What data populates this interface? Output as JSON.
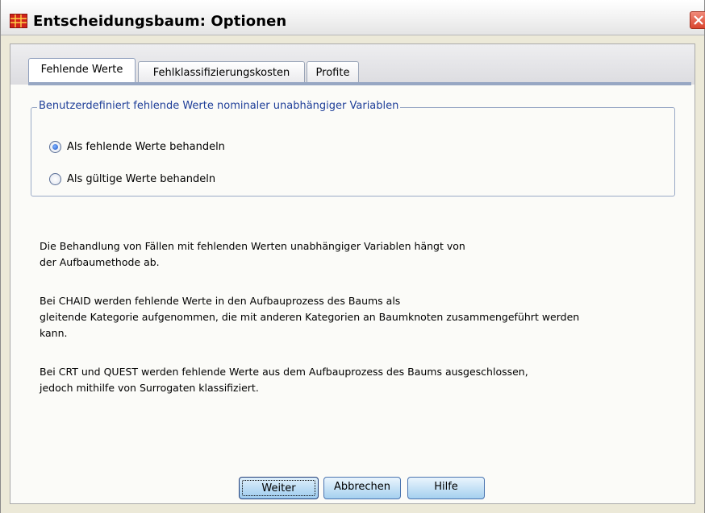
{
  "window": {
    "title": "Entscheidungsbaum: Optionen",
    "icon": "spreadsheet-icon",
    "close_icon": "close-icon"
  },
  "tabs": [
    {
      "label": "Fehlende Werte",
      "active": true
    },
    {
      "label": "Fehlklassifizierungskosten",
      "active": false
    },
    {
      "label": "Profite",
      "active": false
    }
  ],
  "group": {
    "legend": "Benutzerdefiniert fehlende Werte nominaler unabhängiger Variablen",
    "options": [
      {
        "label": "Als fehlende Werte behandeln",
        "checked": true
      },
      {
        "label": "Als gültige Werte behandeln",
        "checked": false
      }
    ]
  },
  "info": {
    "p1_line1": "Die Behandlung von Fällen mit fehlenden Werten unabhängiger Variablen hängt von",
    "p1_line2": "der Aufbaumethode ab.",
    "p2_line1": "Bei CHAID werden fehlende Werte in den Aufbauprozess des Baums als",
    "p2_line2": "gleitende Kategorie aufgenommen, die mit anderen Kategorien an Baumknoten zusammengeführt werden",
    "p2_line3": "kann.",
    "p3_line1": "Bei CRT und QUEST werden fehlende Werte aus dem Aufbauprozess des Baums ausgeschlossen,",
    "p3_line2": "jedoch mithilfe von Surrogaten klassifiziert."
  },
  "buttons": {
    "continue": "Weiter",
    "cancel": "Abbrechen",
    "help": "Hilfe"
  },
  "colors": {
    "legend_text": "#1f3f99",
    "group_border": "#9aaac6",
    "tab_underline": "#97a7c3",
    "dialog_background": "#ece9d8"
  }
}
